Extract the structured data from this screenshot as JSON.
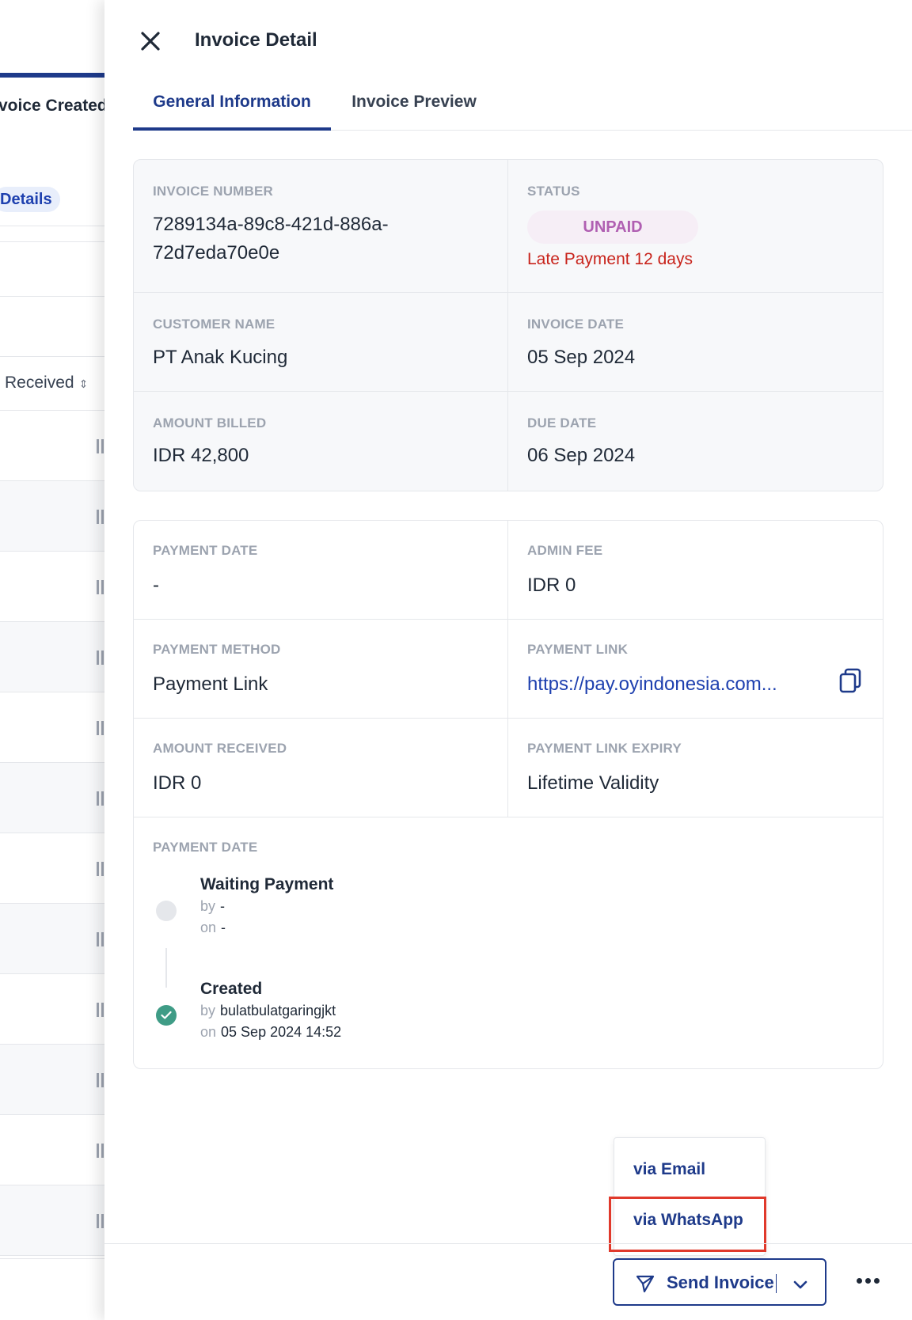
{
  "background": {
    "title_fragment": "voice Created",
    "pill_fragment": "Details",
    "column_header": "Received",
    "row_count": 12
  },
  "drawer": {
    "title": "Invoice Detail",
    "tabs": [
      {
        "label": "General Information",
        "active": true
      },
      {
        "label": "Invoice Preview",
        "active": false
      }
    ]
  },
  "summary": {
    "invoice_number_label": "INVOICE NUMBER",
    "invoice_number_line1": "7289134a-89c8-421d-886a-",
    "invoice_number_line2": "72d7eda70e0e",
    "status_label": "STATUS",
    "status_value": "UNPAID",
    "late_text": "Late Payment 12 days",
    "customer_name_label": "CUSTOMER NAME",
    "customer_name": "PT Anak Kucing",
    "invoice_date_label": "INVOICE DATE",
    "invoice_date": "05 Sep 2024",
    "amount_billed_label": "AMOUNT BILLED",
    "amount_billed": "IDR 42,800",
    "due_date_label": "DUE DATE",
    "due_date": "06 Sep 2024"
  },
  "payment": {
    "payment_date_label": "PAYMENT DATE",
    "payment_date": "-",
    "admin_fee_label": "ADMIN FEE",
    "admin_fee": "IDR 0",
    "payment_method_label": "PAYMENT METHOD",
    "payment_method": "Payment Link",
    "payment_link_label": "PAYMENT LINK",
    "payment_link": "https://pay.oyindonesia.com...",
    "amount_received_label": "AMOUNT RECEIVED",
    "amount_received": "IDR 0",
    "payment_link_expiry_label": "PAYMENT LINK EXPIRY",
    "payment_link_expiry": "Lifetime Validity",
    "history_label": "PAYMENT DATE",
    "history": [
      {
        "title": "Waiting Payment",
        "by_prefix": "by",
        "by": "-",
        "on_prefix": "on",
        "on": "-",
        "state": "pending"
      },
      {
        "title": "Created",
        "by_prefix": "by",
        "by": "bulatbulatgaringjkt",
        "on_prefix": "on",
        "on": "05 Sep 2024 14:52",
        "state": "done"
      }
    ]
  },
  "footer": {
    "send_label": "Send Invoice",
    "dropdown": {
      "email_label": "via Email",
      "whatsapp_label": "via WhatsApp"
    }
  },
  "colors": {
    "primary": "#1e3a8a",
    "status_unpaid_text": "#b05fb2",
    "status_unpaid_bg": "#f6eef6",
    "late_text": "#c8231b",
    "success": "#3f9c86",
    "highlight": "#e0392b"
  },
  "icons": {
    "close": "close-icon",
    "copy": "copy-icon",
    "send": "paper-plane-icon",
    "caret": "chevron-down-icon",
    "more": "more-horizontal-icon",
    "check": "check-icon"
  }
}
